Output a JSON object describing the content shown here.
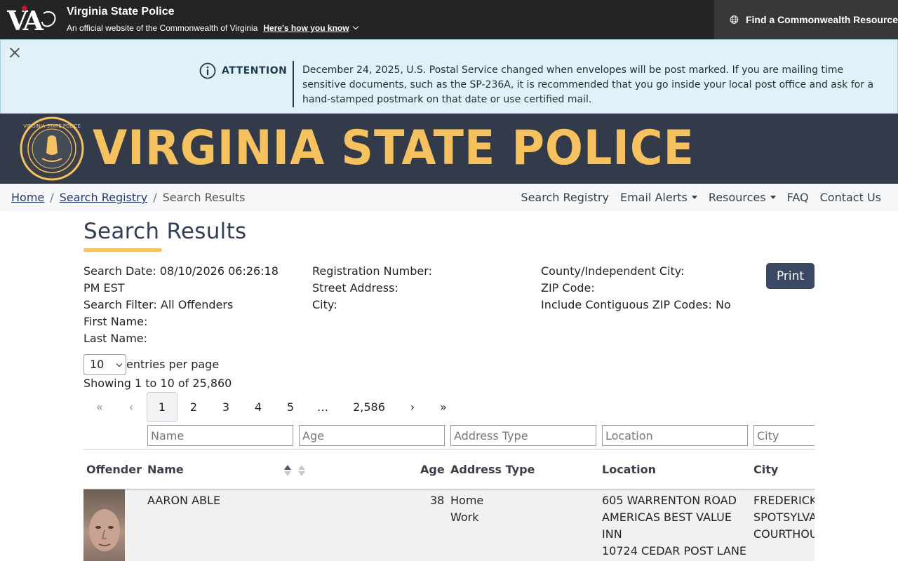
{
  "commonwealth_bar": {
    "title": "Virginia State Police",
    "subtitle": "An official website of the Commonwealth of Virginia",
    "how_label": "Here's how you know",
    "find_resource_label": "Find a Commonwealth Resource",
    "logo_text": "VA"
  },
  "attention": {
    "label": "ATTENTION",
    "message": "December 24, 2025, U.S. Postal Service changed when envelopes will be post marked. If you are mailing time sensitive documents, such as the SP-236A, it is recommended that you go inside your local post office and ask for a hand-stamped postmark on that date or use certified mail."
  },
  "banner": {
    "title": "VIRGINIA STATE POLICE",
    "seal_text": "VIRGINIA STATE POLICE"
  },
  "breadcrumb": {
    "home": "Home",
    "search_registry": "Search Registry",
    "current": "Search Results",
    "separator": "/"
  },
  "nav": {
    "search_registry": "Search Registry",
    "email_alerts": "Email Alerts",
    "resources": "Resources",
    "faq": "FAQ",
    "contact_us": "Contact Us"
  },
  "page": {
    "title": "Search Results",
    "print_label": "Print"
  },
  "criteria": {
    "col1": [
      "Search Date: 08/10/2026 06:26:18 PM EST",
      "Search Filter: All Offenders",
      "First Name:",
      "Last Name:"
    ],
    "col2": [
      "Registration Number:",
      "Street Address:",
      "City:"
    ],
    "col3": [
      "County/Independent City:",
      "ZIP Code:",
      "Include Contiguous ZIP Codes: No"
    ]
  },
  "table_controls": {
    "per_page_value": "10",
    "per_page_label": "entries per page",
    "showing": "Showing 1 to 10 of 25,860"
  },
  "pagination": {
    "first": "«",
    "prev": "‹",
    "pages": [
      "1",
      "2",
      "3",
      "4",
      "5"
    ],
    "active_page": "1",
    "ellipsis": "…",
    "last_page": "2,586",
    "next": "›",
    "last": "»"
  },
  "filters": {
    "name": "Name",
    "age": "Age",
    "address_type": "Address Type",
    "location": "Location",
    "city": "City"
  },
  "columns": {
    "offender": "Offender",
    "name": "Name",
    "age": "Age",
    "address_type": "Address Type",
    "location": "Location",
    "city": "City"
  },
  "rows": [
    {
      "name": "AARON ABLE",
      "age": "38",
      "address_types": [
        "Home",
        "Work"
      ],
      "location_lines": [
        "605 WARRENTON ROAD",
        "AMERICAS BEST VALUE",
        "INN",
        "10724 CEDAR POST LANE"
      ],
      "city_lines": [
        "FREDERICKSBURG",
        "SPOTSYLVANIA",
        "COURTHOUSE"
      ]
    }
  ]
}
